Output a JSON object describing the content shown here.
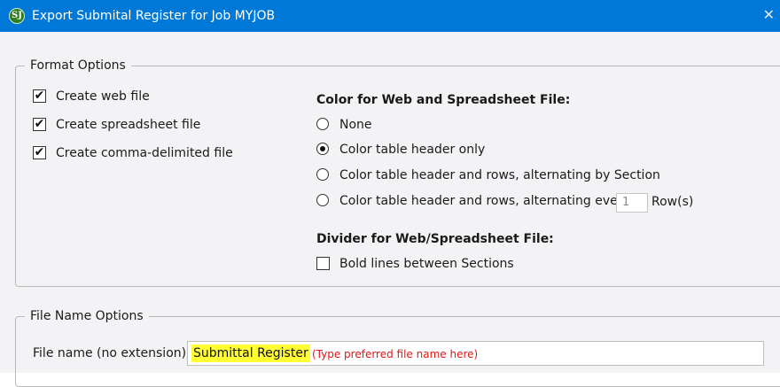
{
  "window": {
    "app_icon_text": "SJ",
    "title": "Export Submital Register for Job MYJOB",
    "close_glyph": "✕"
  },
  "format_options": {
    "legend": "Format Options",
    "checkboxes": [
      {
        "label": "Create web file",
        "checked": true
      },
      {
        "label": "Create spreadsheet file",
        "checked": true
      },
      {
        "label": "Create comma-delimited file",
        "checked": true
      }
    ],
    "color_heading": "Color for Web and Spreadsheet File:",
    "color_options": [
      {
        "label": "None",
        "selected": false
      },
      {
        "label": "Color table header only",
        "selected": true
      },
      {
        "label": "Color table header and rows, alternating by Section",
        "selected": false
      },
      {
        "label": "Color table header and rows, alternating every",
        "selected": false
      }
    ],
    "row_interval": "1",
    "row_suffix": "Row(s)",
    "divider_heading": "Divider for Web/Spreadsheet File:",
    "divider_checkbox": {
      "label": "Bold lines between Sections",
      "checked": false
    }
  },
  "file_name_options": {
    "legend": "File Name Options",
    "field_label": "File name (no extension):",
    "value": "Submittal Register",
    "hint": "(Type preferred file name here)"
  },
  "colors": {
    "titlebar": "#0078d7",
    "highlight": "#ffff33",
    "hint_text": "#e01818"
  }
}
